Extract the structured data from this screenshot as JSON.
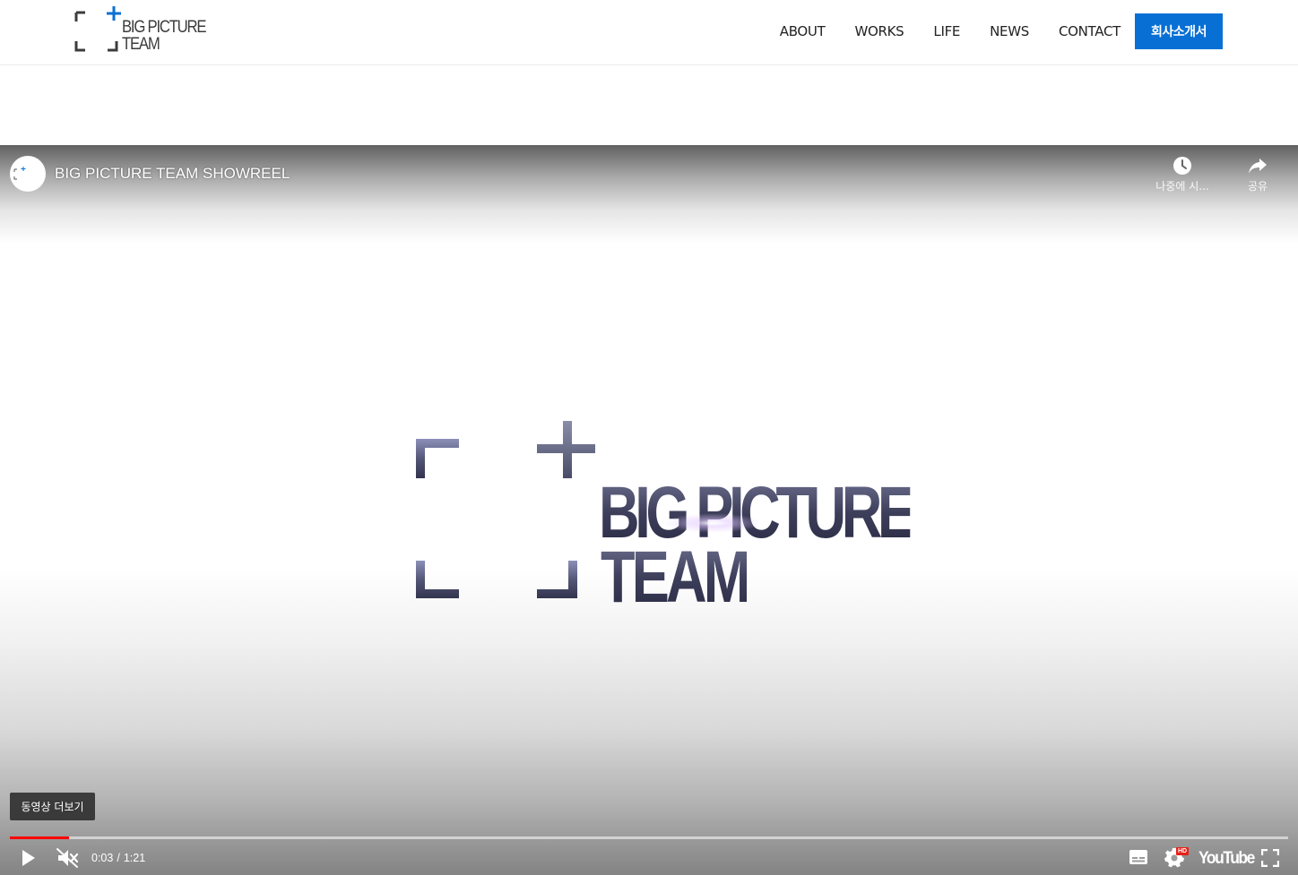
{
  "site": {
    "logo": {
      "line1": "BIG PICTURE",
      "line2": "TEAM",
      "icon": "frame-plus-icon",
      "accent_color": "#0870d4",
      "bracket_color": "#3c3c3c"
    },
    "nav": {
      "items": [
        {
          "label": "ABOUT"
        },
        {
          "label": "WORKS"
        },
        {
          "label": "LIFE"
        },
        {
          "label": "NEWS"
        },
        {
          "label": "CONTACT"
        }
      ],
      "cta_label": "회사소개서",
      "cta_color": "#0870d4"
    }
  },
  "video": {
    "title": "BIG PICTURE TEAM SHOWREEL",
    "channel_avatar": "channel-logo-avatar",
    "top_actions": {
      "watch_later": {
        "label": "나중에 시...",
        "icon": "clock-icon"
      },
      "share": {
        "label": "공유",
        "icon": "share-arrow-icon"
      }
    },
    "frame_logo": {
      "line1": "BIG PICTURE",
      "line2": "TEAM"
    },
    "more_videos_label": "동영상 더보기",
    "current_time": "0:03",
    "duration": "1:21",
    "time_separator": "/",
    "progress_fraction": 0.046,
    "progress_color": "#ff0000",
    "quality_badge": "HD",
    "brand": "YouTube",
    "icons": {
      "play": "play-icon",
      "mute": "muted-speaker-icon",
      "subtitles": "subtitles-icon",
      "settings": "gear-icon",
      "fullscreen": "fullscreen-icon"
    }
  }
}
